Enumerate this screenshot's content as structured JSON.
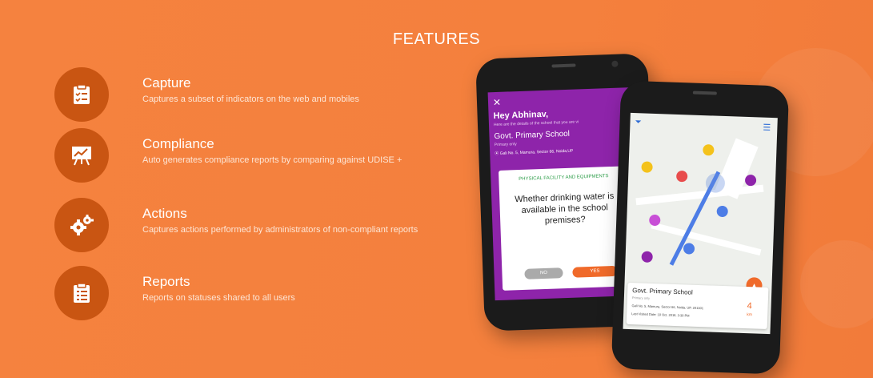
{
  "title": "FEATURES",
  "features": [
    {
      "icon": "clipboard-check-icon",
      "name": "Capture",
      "desc": "Captures a subset of indicators on the web and mobiles"
    },
    {
      "icon": "presentation-chart-icon",
      "name": "Compliance",
      "desc": "Auto generates compliance reports by comparing against UDISE +"
    },
    {
      "icon": "gears-icon",
      "name": "Actions",
      "desc": "Captures actions performed by administrators of non-compliant reports"
    },
    {
      "icon": "report-list-icon",
      "name": "Reports",
      "desc": "Reports on statuses shared to all users"
    }
  ],
  "phone1": {
    "greeting": "Hey Abhinav,",
    "subtitle": "Here are the details of the school that you are vi",
    "school": "Govt. Primary School",
    "school_type": "Primary only",
    "address": "Gali No. 5, Mamura, Sector 66, Noida,UP",
    "category": "PHYSICAL FACILITY AND EQUIPMENTS",
    "question": "Whether drinking water is available in the school premises?",
    "no_label": "NO",
    "yes_label": "YES"
  },
  "phone2": {
    "card_title": "Govt. Primary School",
    "card_sub": "Primary only",
    "address": "Gali No. 5, Mamura, Sector 66, Noida, UP, 201301",
    "last_visited": "Last Visited Date: 10 Oct, 2018, 3:30 PM",
    "count": "4",
    "count_unit": "km"
  },
  "colors": {
    "background": "#f4803f",
    "icon_circle": "#c95512",
    "purple": "#8e24aa",
    "accent": "#f06a2a"
  }
}
